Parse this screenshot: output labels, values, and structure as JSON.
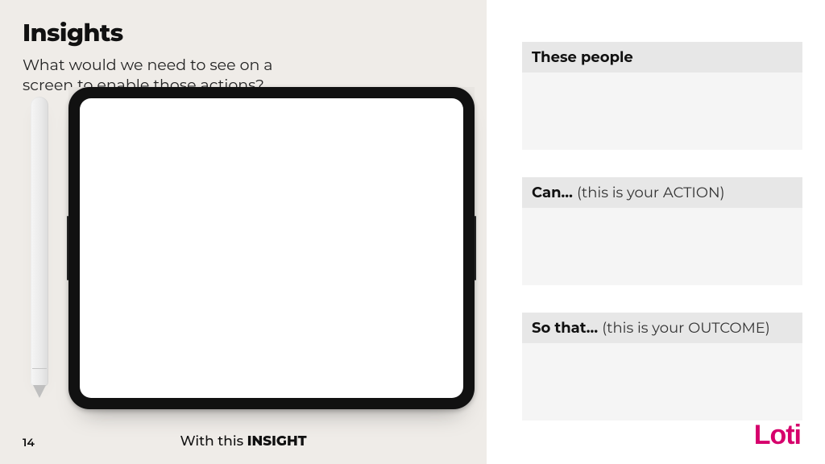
{
  "title": "Insights",
  "subtitle": "What would we need to see on a screen to enable those actions?",
  "page_number": "14",
  "footer_prefix": "With this ",
  "footer_bold": "INSIGHT",
  "sections": [
    {
      "bold": "These people",
      "hint": ""
    },
    {
      "bold": "Can… ",
      "hint": "(this is your ACTION)"
    },
    {
      "bold": "So that… ",
      "hint": "(this is your OUTCOME)"
    }
  ],
  "logo_text": "Loti"
}
